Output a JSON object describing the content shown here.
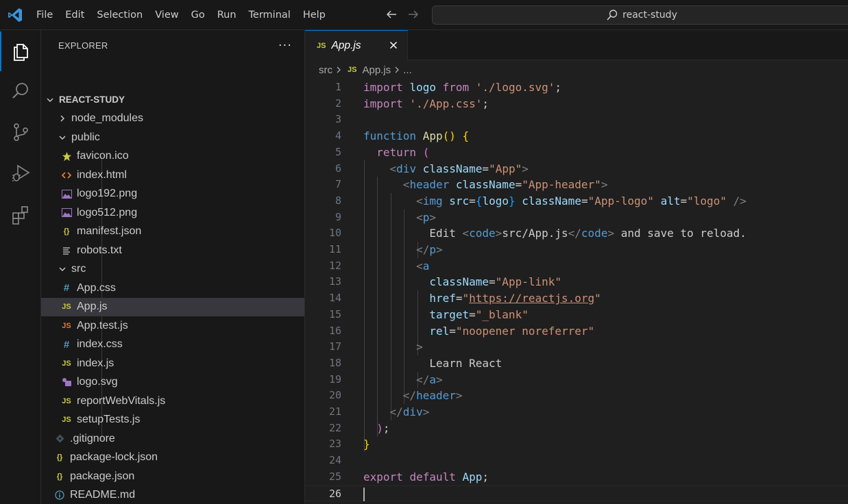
{
  "menu": [
    "File",
    "Edit",
    "Selection",
    "View",
    "Go",
    "Run",
    "Terminal",
    "Help"
  ],
  "command_center": {
    "label": "react-study"
  },
  "activity": {
    "explorer_icon": "files-icon",
    "search_icon": "search-icon",
    "scm_icon": "source-control-icon",
    "debug_icon": "run-debug-icon",
    "extensions_icon": "extensions-icon"
  },
  "sidebar": {
    "title": "EXPLORER",
    "more": "···",
    "root": "REACT-STUDY",
    "items": [
      {
        "label": "node_modules",
        "kind": "folder",
        "icon": "chevron-right-icon"
      },
      {
        "label": "public",
        "kind": "folder",
        "icon": "chevron-down-icon"
      },
      {
        "label": "favicon.ico",
        "kind": "file",
        "icon": "star-icon"
      },
      {
        "label": "index.html",
        "kind": "file",
        "icon": "html-icon"
      },
      {
        "label": "logo192.png",
        "kind": "file",
        "icon": "image-icon"
      },
      {
        "label": "logo512.png",
        "kind": "file",
        "icon": "image-icon"
      },
      {
        "label": "manifest.json",
        "kind": "file",
        "icon": "json-icon"
      },
      {
        "label": "robots.txt",
        "kind": "file",
        "icon": "text-lines-icon"
      },
      {
        "label": "src",
        "kind": "folder",
        "icon": "chevron-down-icon"
      },
      {
        "label": "App.css",
        "kind": "file",
        "icon": "css-hash-icon"
      },
      {
        "label": "App.js",
        "kind": "file",
        "icon": "js-icon"
      },
      {
        "label": "App.test.js",
        "kind": "file",
        "icon": "js-test-icon"
      },
      {
        "label": "index.css",
        "kind": "file",
        "icon": "css-hash-icon"
      },
      {
        "label": "index.js",
        "kind": "file",
        "icon": "js-icon"
      },
      {
        "label": "logo.svg",
        "kind": "file",
        "icon": "svg-icon"
      },
      {
        "label": "reportWebVitals.js",
        "kind": "file",
        "icon": "js-icon"
      },
      {
        "label": "setupTests.js",
        "kind": "file",
        "icon": "js-icon"
      },
      {
        "label": ".gitignore",
        "kind": "file",
        "icon": "git-icon"
      },
      {
        "label": "package-lock.json",
        "kind": "file",
        "icon": "json-icon"
      },
      {
        "label": "package.json",
        "kind": "file",
        "icon": "json-icon"
      },
      {
        "label": "README.md",
        "kind": "file",
        "icon": "info-icon"
      }
    ],
    "selected": "App.js"
  },
  "editor": {
    "tab": {
      "badge": "JS",
      "label": "App.js"
    },
    "breadcrumb": {
      "folder": "src",
      "badge": "JS",
      "file": "App.js",
      "more": "..."
    },
    "active_line": 26,
    "lines": [
      "import logo from './logo.svg';",
      "import './App.css';",
      "",
      "function App() {",
      "  return (",
      "    <div className=\"App\">",
      "      <header className=\"App-header\">",
      "        <img src={logo} className=\"App-logo\" alt=\"logo\" />",
      "        <p>",
      "          Edit <code>src/App.js</code> and save to reload.",
      "        </p>",
      "        <a",
      "          className=\"App-link\"",
      "          href=\"https://reactjs.org\"",
      "          target=\"_blank\"",
      "          rel=\"noopener noreferrer\"",
      "        >",
      "          Learn React",
      "        </a>",
      "      </header>",
      "    </div>",
      "  );",
      "}",
      "",
      "export default App;",
      ""
    ]
  },
  "colors": {
    "accent": "#0078d4",
    "js_badge": "#cbcb41",
    "css_badge": "#519aba",
    "html_badge": "#e37933",
    "test_badge": "#e37933",
    "svg_badge": "#a074c4"
  }
}
